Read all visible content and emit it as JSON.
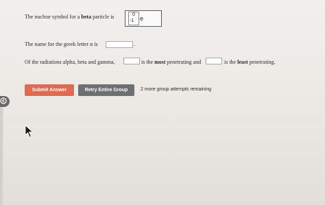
{
  "question1": {
    "prefix": "The nuclear symbol for a ",
    "bold": "beta",
    "suffix": " particle is",
    "symbol": {
      "mass_number": "0",
      "atomic_number": "-1",
      "element": "e"
    }
  },
  "question2": {
    "text": "The name for the greek letter α is",
    "answer": "",
    "end_punct": "."
  },
  "question3": {
    "part1": "Of the radiations alpha, beta and gamma,",
    "answer1": "",
    "part2_pre": "is the ",
    "part2_bold": "most",
    "part2_post": " penetrating and",
    "answer2": "",
    "part3_pre": "is the ",
    "part3_bold": "least",
    "part3_post": " penetrating."
  },
  "actions": {
    "submit_label": "Submit Answer",
    "retry_label": "Retry Entire Group",
    "attempts_text": "2 more group attempts remaining"
  },
  "colors": {
    "submit_bg": "#e06b4f",
    "retry_bg": "#6e6f73",
    "handle_bg": "#6b6a6a"
  },
  "icons": {
    "side_handle": "chevron-left-icon",
    "pointer": "mouse-pointer-icon"
  }
}
